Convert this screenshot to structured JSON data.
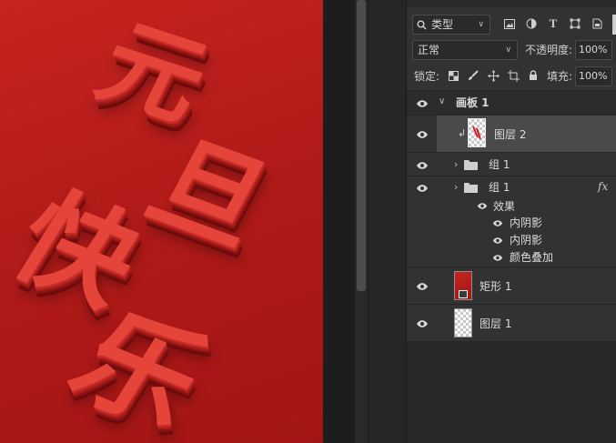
{
  "canvas": {
    "characters": [
      "元",
      "旦",
      "快",
      "乐"
    ],
    "colors": {
      "bg": "#b21b19",
      "text": "#e4443a",
      "extrude": "#8c1212"
    }
  },
  "layers_panel": {
    "filter_kind": "类型",
    "blend_mode": "正常",
    "opacity_label": "不透明度:",
    "opacity_value": "100%",
    "lock_label": "锁定:",
    "fill_label": "填充:",
    "fill_value": "100%",
    "artboard_name": "画板 1",
    "layers": [
      {
        "name": "图层 2",
        "type": "pixel",
        "clipped": true,
        "selected": true
      },
      {
        "name": "组 1",
        "type": "group"
      },
      {
        "name": "组 1",
        "type": "group",
        "fx": "fx",
        "effects_label": "效果",
        "effects": [
          "内阴影",
          "内阴影",
          "颜色叠加"
        ]
      },
      {
        "name": "矩形 1",
        "type": "shape"
      },
      {
        "name": "图层 1",
        "type": "pixel"
      }
    ]
  },
  "icons": [
    "search-icon",
    "image-filter-icon",
    "adjustment-filter-icon",
    "type-filter-icon",
    "shape-filter-icon",
    "smart-object-filter-icon",
    "eye-icon",
    "folder-icon",
    "chevron-right-icon",
    "chevron-down-icon",
    "lock-icon",
    "move-icon",
    "brush-icon",
    "checkerboard-icon",
    "artboard-icon"
  ]
}
